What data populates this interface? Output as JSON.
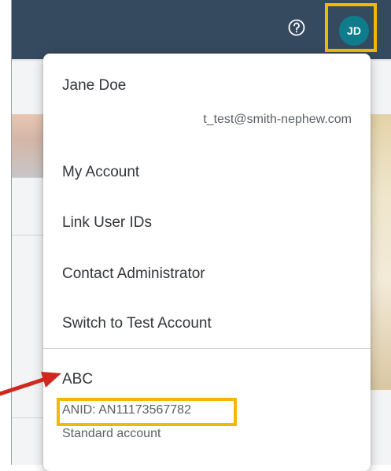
{
  "shellbar": {
    "help_icon": "help-circle-icon",
    "avatar_initials": "JD"
  },
  "user_menu": {
    "name": "Jane Doe",
    "email": "t_test@smith-nephew.com",
    "items": [
      {
        "label": "My Account"
      },
      {
        "label": "Link User IDs"
      },
      {
        "label": "Contact Administrator"
      },
      {
        "label": "Switch to Test Account"
      }
    ],
    "organization": {
      "name": "ABC",
      "anid": "ANID: AN11173567782",
      "account_type": "Standard account"
    }
  },
  "colors": {
    "shellbar_bg": "#354a5f",
    "avatar_bg": "#0f7c8c",
    "highlight": "#f5b800",
    "arrow": "#d0281f"
  }
}
